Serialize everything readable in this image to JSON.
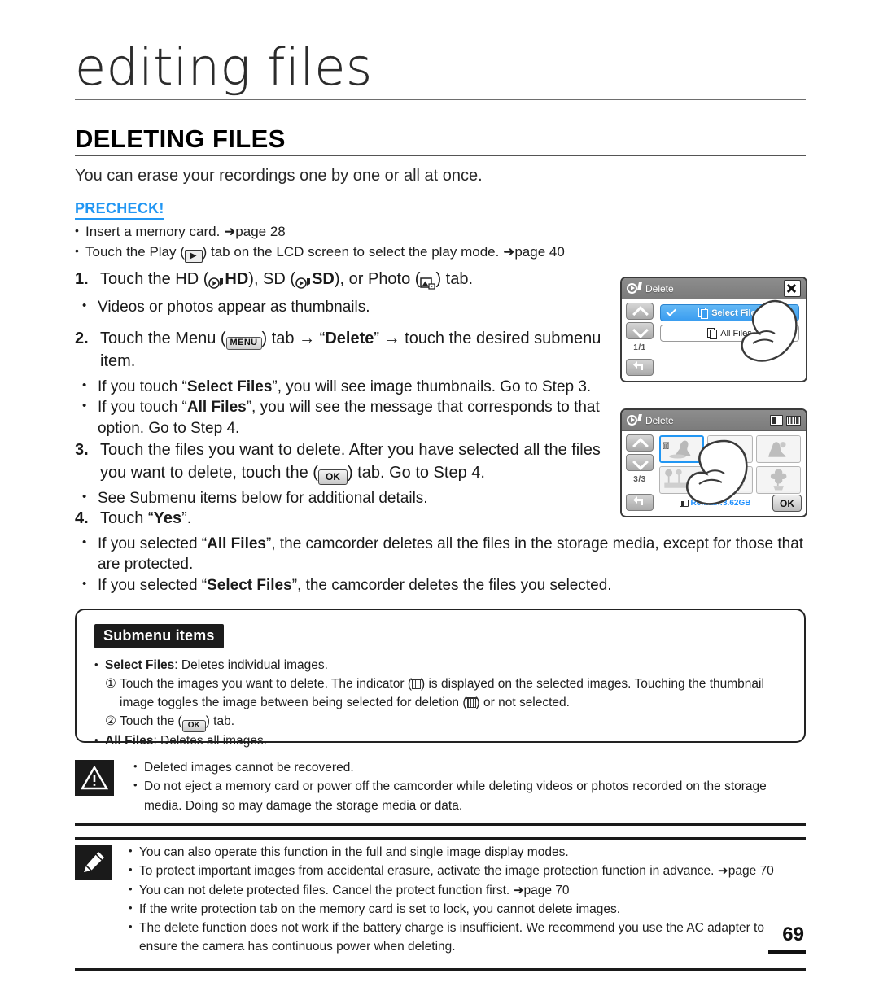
{
  "chapter": {
    "title": "editing files"
  },
  "section": {
    "heading": "DELETING FILES",
    "intro": "You can erase your recordings one by one or all at once."
  },
  "precheck": {
    "label": "PRECHECK!",
    "items": [
      "Insert a memory card. ➜ page 28",
      "Touch the Play (  ) tab on the LCD screen to select the play mode. ➜ page 40"
    ],
    "item1_pre": "Insert a memory card. ",
    "item1_ref": "➜page 28",
    "item2_pre": "Touch the Play (",
    "item2_mid": ") tab on the LCD screen to select the play mode. ",
    "item2_ref": "➜page 40"
  },
  "steps": [
    {
      "num": "1.",
      "text_a": "Touch the HD (",
      "hd_label": "HD",
      "text_b": "), SD (",
      "sd_label": "SD",
      "text_c": "), or Photo (",
      "text_d": ") tab.",
      "bullets": [
        "Videos or photos appear as thumbnails."
      ]
    },
    {
      "num": "2.",
      "text_a": "Touch the Menu (",
      "menu_label": "MENU",
      "text_b": ") tab → “",
      "bold_b": "Delete",
      "text_c": "” → touch the desired submenu item.",
      "bullets": [
        {
          "pre": "If you touch “",
          "bold": "Select Files",
          "post": "”, you will see image thumbnails. Go to Step 3."
        },
        {
          "pre": "If you touch “",
          "bold": "All Files",
          "post": "”, you will see the message that corresponds to that option. Go to Step 4."
        }
      ]
    },
    {
      "num": "3.",
      "text_a": "Touch the files you want to delete. After you have selected all the files you want to delete, touch the (",
      "ok_label": "OK",
      "text_b": ") tab. Go to Step 4.",
      "bullets": [
        "See Submenu items below for additional details."
      ]
    },
    {
      "num": "4.",
      "text_a": "Touch “",
      "bold_a": "Yes",
      "text_b": "”.",
      "bullets": [
        {
          "pre": "If you selected “",
          "bold": "All Files",
          "post": "”, the camcorder deletes all the files in the storage media, except for those that are protected."
        },
        {
          "pre": "If you selected “",
          "bold": "Select Files",
          "post": "”, the camcorder deletes the files you selected."
        }
      ]
    }
  ],
  "lcd1": {
    "title": "Delete",
    "page_indicator": "1/1",
    "items": [
      {
        "label": "Select Files",
        "selected": true
      },
      {
        "label": "All Files",
        "selected": false
      }
    ]
  },
  "lcd2": {
    "title": "Delete",
    "page_indicator": "3/3",
    "remain": "Remain:3.62GB",
    "ok_label": "OK",
    "thumbnails": [
      {
        "selected": true
      },
      {
        "selected": false
      },
      {
        "selected": false
      },
      {
        "selected": false
      },
      {
        "selected": false
      },
      {
        "selected": false
      }
    ]
  },
  "submenu": {
    "title": "Submenu items",
    "item1_bold": "Select Files",
    "item1_rest": ": Deletes individual images.",
    "sub1_mark": "①",
    "sub1_a": "Touch the images you want to delete. The indicator (",
    "sub1_b": ") is displayed on the selected images. Touching the thumbnail image toggles the image between being selected for deletion (",
    "sub1_c": ") or not selected.",
    "sub2_mark": "②",
    "sub2_a": "Touch the (",
    "sub2_ok": "OK",
    "sub2_b": ") tab.",
    "item2_bold": "All Files",
    "item2_rest": ": Deletes all images."
  },
  "caution": {
    "items": [
      "Deleted images cannot be recovered.",
      "Do not eject a memory card or power off the camcorder while deleting videos or photos recorded on the storage media. Doing so may damage the storage media or data."
    ]
  },
  "notes": {
    "items": [
      "You can also operate this function in the full and single image display modes.",
      "To protect important images from accidental erasure, activate the image protection function in advance. ➜page 70",
      "You can not delete protected files. Cancel the protect function first. ➜page 70",
      "If the write protection tab on the memory card is set to lock, you cannot delete images.",
      "The delete function does not work if the battery charge is insufficient. We recommend you use the AC adapter to ensure the camera has continuous power when deleting."
    ]
  },
  "footer": {
    "page_number": "69"
  },
  "colors": {
    "precheck_blue": "#2196f3",
    "lcd_select_blue": "#3a9df0",
    "remain_blue": "#1e90ff",
    "ink": "#1a1a1a"
  }
}
